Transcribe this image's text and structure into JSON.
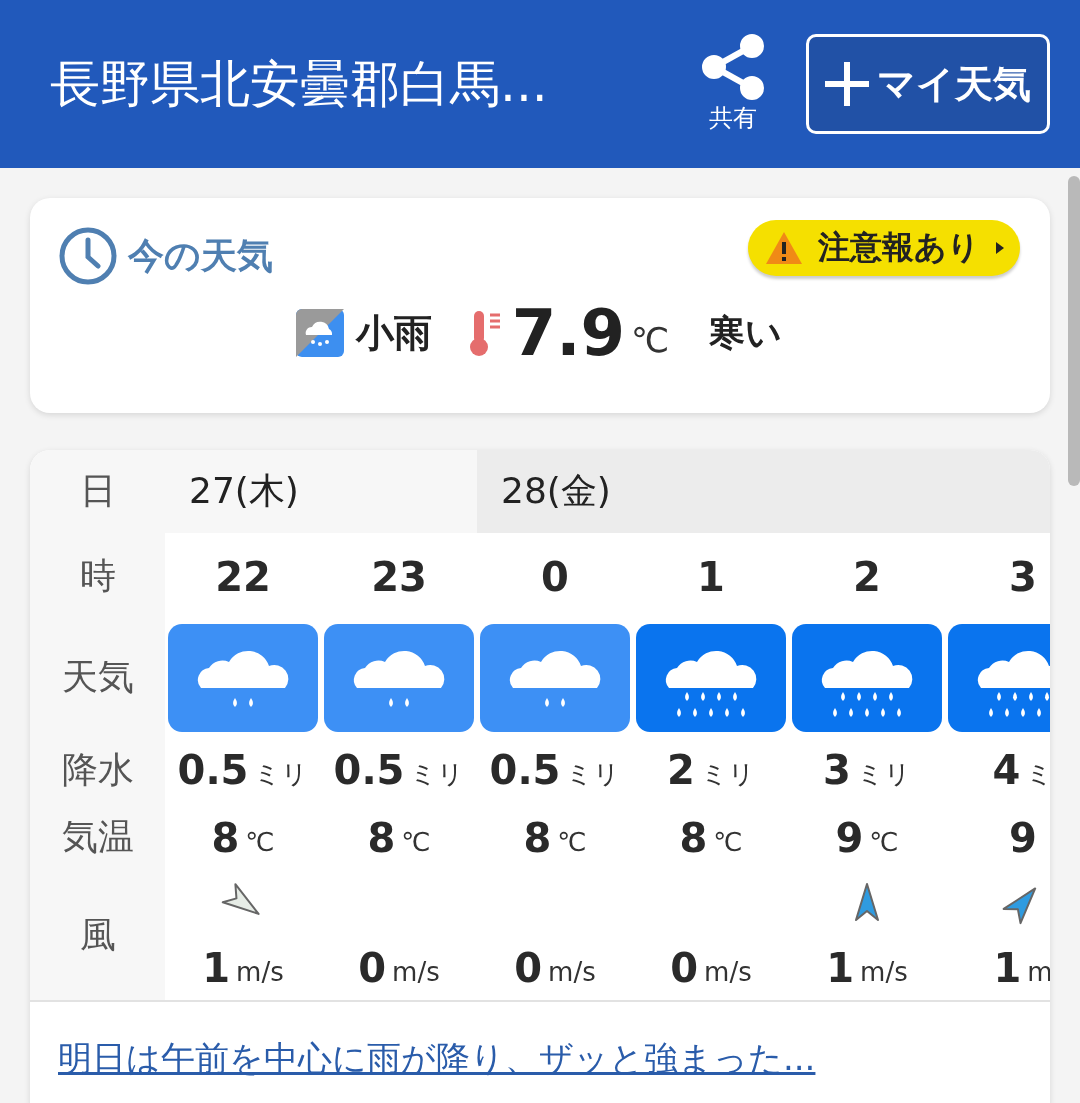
{
  "header": {
    "title": "長野県北安曇郡白馬...",
    "share_label": "共有",
    "my_weather_button": "マイ天気"
  },
  "current": {
    "heading": "今の天気",
    "alert": "注意報あり",
    "condition": "小雨",
    "temperature": "7.9",
    "temperature_unit": "℃",
    "feeling": "寒い"
  },
  "forecast": {
    "row_labels": {
      "date": "日",
      "hour": "時",
      "weather": "天気",
      "precip": "降水",
      "temp": "気温",
      "wind": "風"
    },
    "days": [
      {
        "label": "27(木)",
        "hours": [
          {
            "hour": "22",
            "kind": "light_rain",
            "precip": "0.5",
            "precip_unit": "ミリ",
            "temp": "8",
            "temp_unit": "℃",
            "wind_arrow": {
              "kind": "southeast",
              "color": "#e6ece6"
            },
            "wind": "1",
            "wind_unit": "m/s"
          },
          {
            "hour": "23",
            "kind": "light_rain",
            "precip": "0.5",
            "precip_unit": "ミリ",
            "temp": "8",
            "temp_unit": "℃",
            "wind": "0",
            "wind_unit": "m/s"
          }
        ]
      },
      {
        "label": "28(金)",
        "hours": [
          {
            "hour": "0",
            "kind": "light_rain",
            "precip": "0.5",
            "precip_unit": "ミリ",
            "temp": "8",
            "temp_unit": "℃",
            "wind": "0",
            "wind_unit": "m/s"
          },
          {
            "hour": "1",
            "kind": "rain",
            "precip": "2",
            "precip_unit": "ミリ",
            "temp": "8",
            "temp_unit": "℃",
            "wind": "0",
            "wind_unit": "m/s"
          },
          {
            "hour": "2",
            "kind": "rain",
            "precip": "3",
            "precip_unit": "ミリ",
            "temp": "9",
            "temp_unit": "℃",
            "wind_arrow": {
              "kind": "north",
              "color": "#2f9be0"
            },
            "wind": "1",
            "wind_unit": "m/s"
          },
          {
            "hour": "3",
            "kind": "rain",
            "precip": "4",
            "precip_unit": "ミ",
            "temp": "9",
            "wind_arrow": {
              "kind": "northeast",
              "color": "#2f9be0"
            },
            "wind": "1",
            "wind_unit": "m"
          }
        ]
      }
    ]
  },
  "summary_link": "明日は午前を中心に雨が降り、ザッと強まった..."
}
